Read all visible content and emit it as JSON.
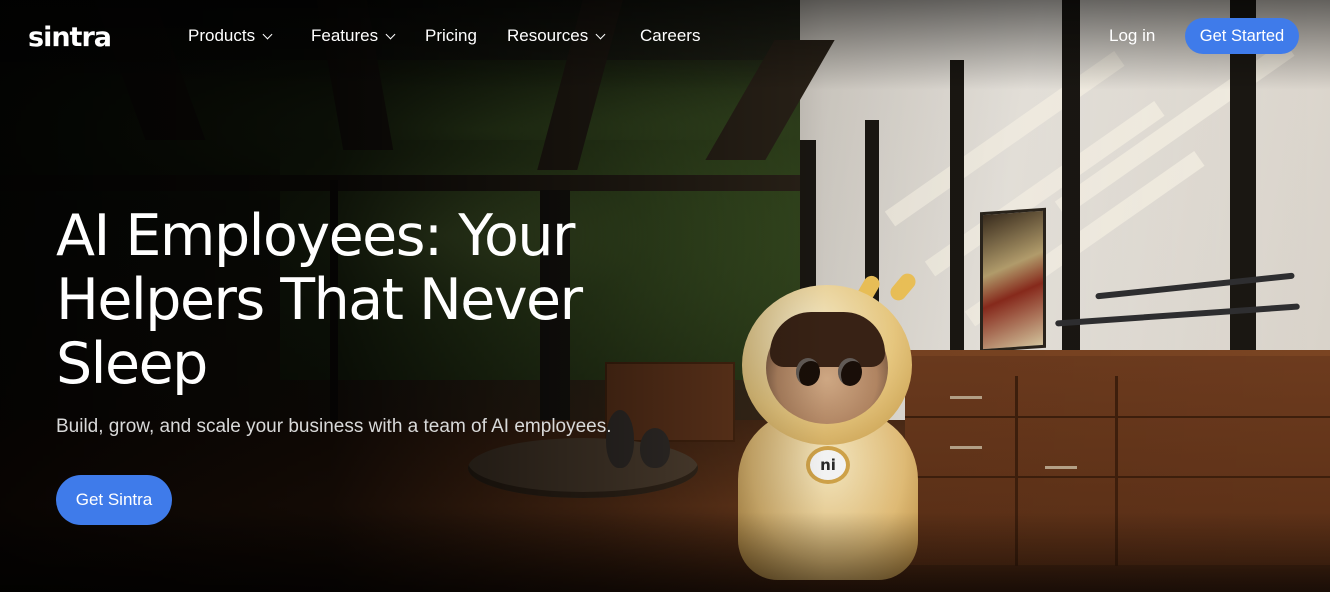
{
  "brand": {
    "logo_text": "sintra"
  },
  "nav": {
    "links": [
      {
        "label": "Products",
        "has_dropdown": true
      },
      {
        "label": "Features",
        "has_dropdown": true
      },
      {
        "label": "Pricing",
        "has_dropdown": false
      },
      {
        "label": "Resources",
        "has_dropdown": true
      },
      {
        "label": "Careers",
        "has_dropdown": false
      }
    ],
    "login_label": "Log in",
    "get_started_label": "Get Started"
  },
  "hero": {
    "title_line1": "AI Employees: Your",
    "title_line2": "Helpers That Never",
    "title_line3": "Sleep",
    "subtitle": "Build, grow, and scale your business with a team of AI employees.",
    "cta_label": "Get Sintra",
    "mascot_badge": "ni"
  },
  "colors": {
    "accent": "#3f7bea",
    "text": "#ffffff",
    "subtitle": "#d9d9d9"
  }
}
